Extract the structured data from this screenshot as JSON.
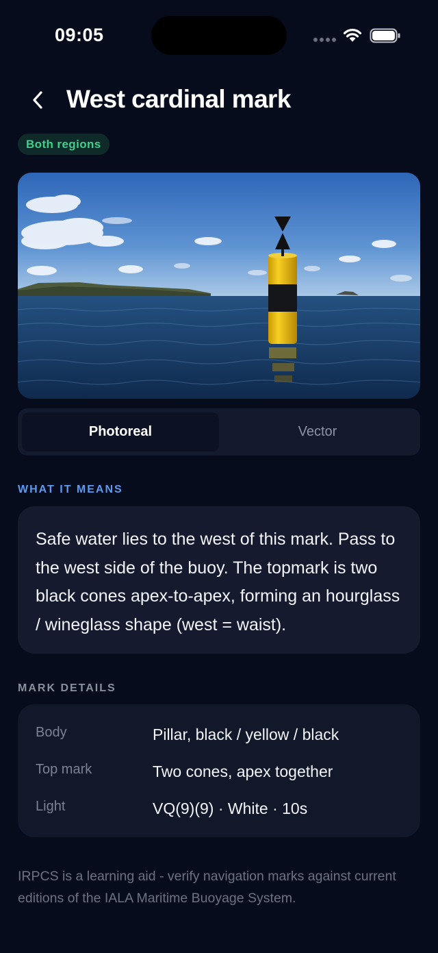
{
  "status_bar": {
    "time": "09:05"
  },
  "header": {
    "back_icon": "chevron-left-icon",
    "title": "West cardinal mark",
    "badge": "Both regions"
  },
  "image": {
    "description_icon": "west-cardinal-buoy-photo"
  },
  "view_toggle": {
    "options": [
      "Photoreal",
      "Vector"
    ],
    "selected": "Photoreal"
  },
  "meaning": {
    "label": "WHAT IT MEANS",
    "text": "Safe water lies to the west of this mark. Pass to the west side of the buoy. The topmark is two black cones apex-to-apex, forming an hourglass / wineglass shape (west = waist)."
  },
  "details": {
    "label": "MARK DETAILS",
    "rows": [
      {
        "key": "Body",
        "value": "Pillar, black / yellow / black"
      },
      {
        "key": "Top mark",
        "value": "Two cones, apex together"
      },
      {
        "key": "Light",
        "value": "VQ(9)(9) · White · 10s"
      }
    ]
  },
  "footer": {
    "disclaimer": "IRPCS is a learning aid - verify navigation marks against current editions of the IALA Maritime Buoyage System."
  },
  "colors": {
    "background": "#070c1c",
    "accent_blue": "#5b9bf0",
    "badge_green": "#3ecf8e",
    "buoy_yellow": "#f2c40f"
  }
}
